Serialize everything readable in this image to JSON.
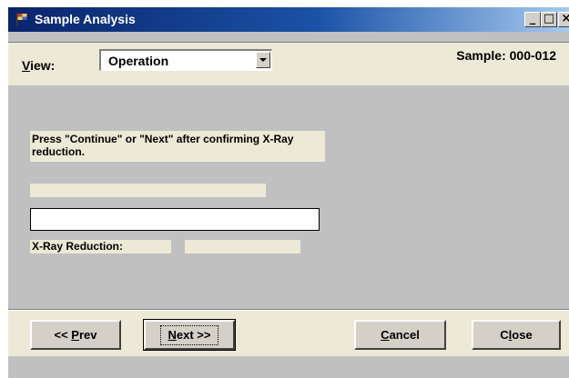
{
  "window": {
    "title": "Sample Analysis",
    "minimize_glyph": "_",
    "maximize_glyph": "□",
    "close_glyph": "×"
  },
  "header": {
    "view_label_accel": "V",
    "view_label_rest": "iew:",
    "view_selected": "Operation",
    "sample_label": "Sample: 000-012"
  },
  "main": {
    "message": "Press \"Continue\" or \"Next\" after confirming X-Ray reduction.",
    "input_value": "",
    "xray_label": "X-Ray Reduction:",
    "xray_value": ""
  },
  "buttons": {
    "prev_pre": "<< ",
    "prev_accel": "P",
    "prev_rest": "rev",
    "next_accel": "N",
    "next_rest": "ext >>",
    "cancel_accel": "C",
    "cancel_rest": "ancel",
    "close_pre": "C",
    "close_accel": "l",
    "close_rest": "ose"
  },
  "colors": {
    "title_gradient_start": "#0a246a",
    "title_gradient_end": "#a6caf0",
    "panel": "#c0c0c0",
    "band": "#ece9d6"
  },
  "icons": [
    "app-icon",
    "minimize-icon",
    "maximize-icon",
    "close-icon",
    "chevron-down-icon"
  ]
}
